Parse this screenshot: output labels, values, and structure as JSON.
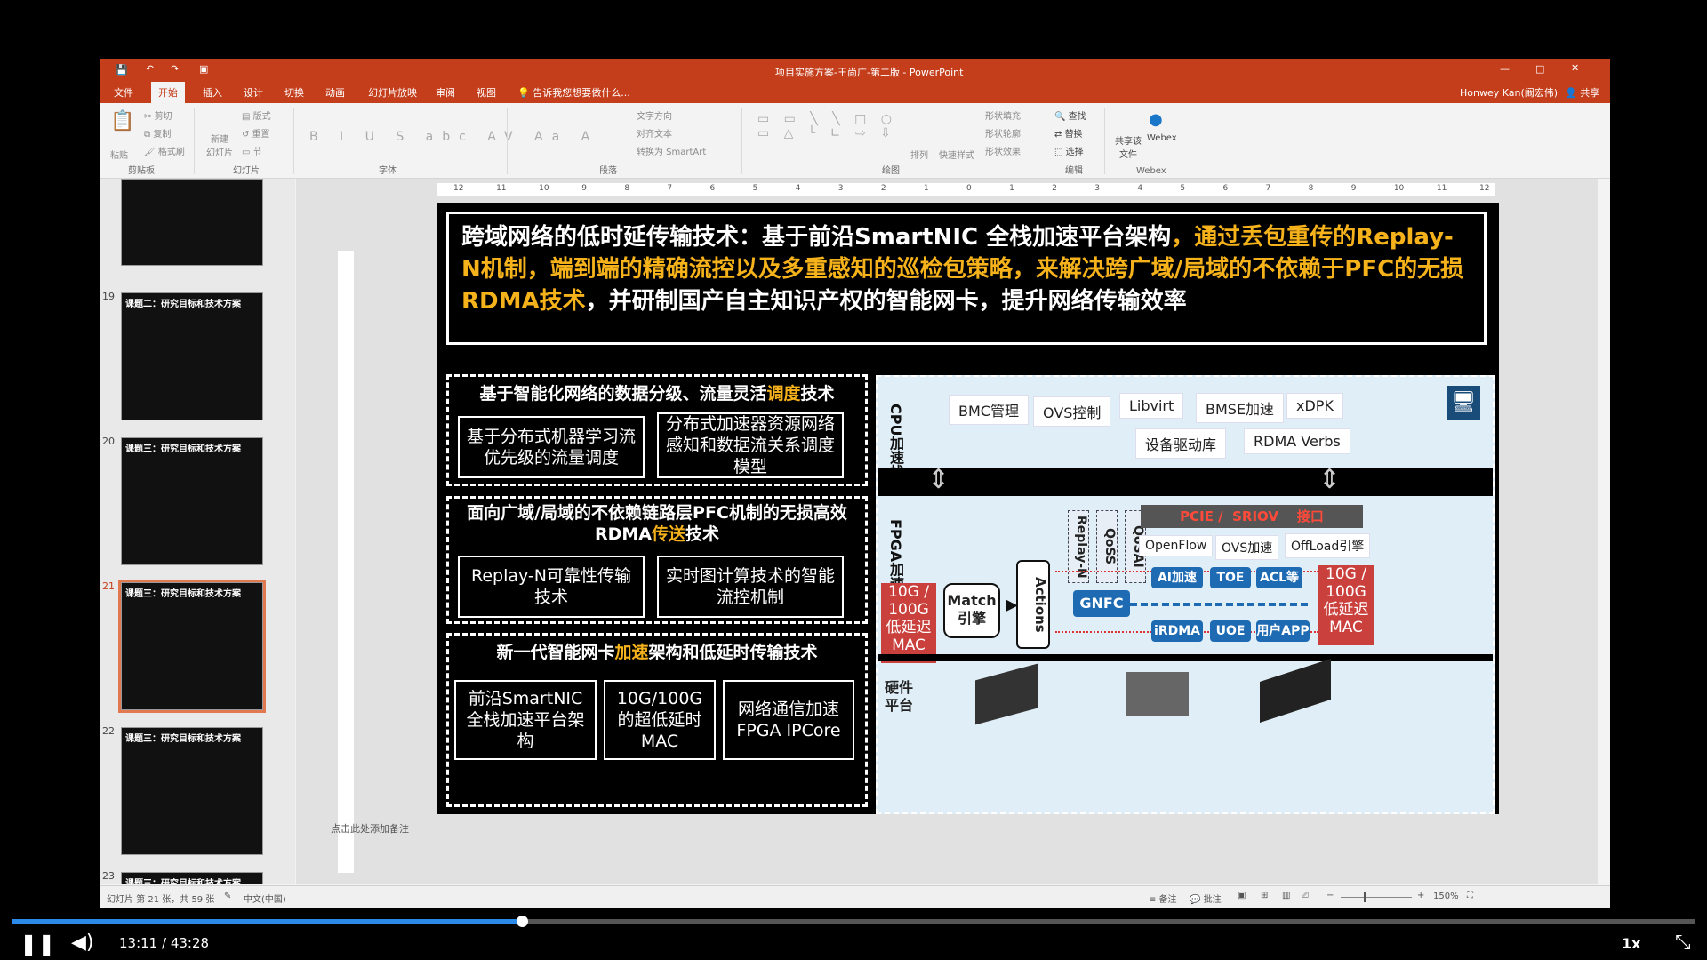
{
  "window": {
    "title": "项目实施方案-王尚广-第二版 - PowerPoint",
    "user": "Honwey Kan(阚宏伟)",
    "share": "共享"
  },
  "tabs": [
    "文件",
    "开始",
    "插入",
    "设计",
    "切换",
    "动画",
    "幻灯片放映",
    "审阅",
    "视图"
  ],
  "tell_me": "告诉我您想要做什么...",
  "ribbon": {
    "paste": "粘贴",
    "cut": "剪切",
    "copy": "复制",
    "format_painter": "格式刷",
    "new_slide": "新建\n幻灯片",
    "layout": "版式",
    "reset": "重置",
    "section": "节",
    "text_direction": "文字方向",
    "align_text": "对齐文本",
    "convert_smartart": "转换为 SmartArt",
    "arrange": "排列",
    "quick_styles": "快速样式",
    "shape_fill": "形状填充",
    "shape_outline": "形状轮廓",
    "shape_effects": "形状效果",
    "find": "查找",
    "replace": "替换",
    "select": "选择",
    "share_file": "共享该\n文件",
    "webex": "Webex",
    "groups": [
      "剪贴板",
      "幻灯片",
      "字体",
      "段落",
      "绘图",
      "编辑",
      "Webex"
    ]
  },
  "ruler_marks": [
    "12",
    "11",
    "10",
    "9",
    "8",
    "7",
    "6",
    "5",
    "4",
    "3",
    "2",
    "1",
    "0",
    "1",
    "2",
    "3",
    "4",
    "5",
    "6",
    "7",
    "8",
    "9",
    "10",
    "11",
    "12"
  ],
  "thumbnails": [
    {
      "num": "19",
      "title": "课题二：研究目标和技术方案",
      "selected": false
    },
    {
      "num": "20",
      "title": "课题三：研究目标和技术方案",
      "selected": false
    },
    {
      "num": "21",
      "title": "课题三：研究目标和技术方案",
      "selected": true
    },
    {
      "num": "22",
      "title": "课题三：研究目标和技术方案",
      "selected": false
    },
    {
      "num": "23",
      "title": "课题三：研究目标和技术方案",
      "selected": false
    }
  ],
  "slide": {
    "headline_white1": "跨域网络的低时延传输技术：基于前沿SmartNIC 全栈加速平台架构",
    "headline_orange": "，通过丢包重传的Replay-N机制，端到端的精确流控以及多重感知的巡检包策略，来解决跨广域/局域的不依赖于PFC的无损RDMA技术",
    "headline_white2": "，并研制国产自主知识产权的智能网卡，提升网络传输效率",
    "section1": {
      "title_a": "基于智能化网络的数据分级、流量灵活",
      "title_hl": "调度",
      "title_b": "技术",
      "box1": "基于分布式机器学习流优先级的流量调度",
      "box2": "分布式加速器资源网络感知和数据流关系调度模型"
    },
    "section2": {
      "title_a": "面向广域/局域的不依赖链路层PFC机制的无损高效RDMA",
      "title_hl": "传送",
      "title_b": "技术",
      "box1": "Replay-N可靠性传输技术",
      "box2": "实时图计算技术的智能流控机制"
    },
    "section3": {
      "title_a": "新一代智能网卡",
      "title_hl": "加速",
      "title_b": "架构和低延时传输技术",
      "box1": "前沿SmartNIC全栈加速平台架构",
      "box2": "10G/100G的超低延时MAC",
      "box3": "网络通信加速FPGA IPCore"
    },
    "arch": {
      "cpu_label": "CPU加速栈",
      "cpu_items": [
        "BMC管理",
        "OVS控制",
        "Libvirt",
        "BMSE加速",
        "xDPK",
        "设备驱动库",
        "RDMA Verbs"
      ],
      "fpga_label": "FPGA加速栈",
      "vert_labels": [
        "Replay-N",
        "QoSS",
        "QoSAI"
      ],
      "pcie": "PCIE /  SRIOV    接口",
      "fpga_items": [
        "OpenFlow",
        "OVS加速",
        "OffLoad引擎"
      ],
      "mac_left": "10G /\n100G\n低延迟\nMAC",
      "mac_right": "10G /\n100G\n低延迟\nMAC",
      "match": "Match\n引擎",
      "actions": "Actions",
      "gnfc": "GNFC",
      "blue_items": [
        "AI加速",
        "TOE",
        "ACL等",
        "iRDMA",
        "UOE",
        "用户APP"
      ],
      "hw_label": "硬件平台"
    }
  },
  "notes_placeholder": "点击此处添加备注",
  "status": {
    "slide_info": "幻灯片 第 21 张，共 59 张",
    "language": "中文(中国)",
    "notes": "备注",
    "comments": "批注",
    "zoom": "150%"
  },
  "video": {
    "time": "13:11 / 43:28",
    "speed": "1x",
    "progress": 0.303
  },
  "colors": {
    "accent": "#c43e1c",
    "highlight": "#f6b21b",
    "diagram_blue": "#1e6ab3",
    "mac_red": "#c9403c"
  }
}
